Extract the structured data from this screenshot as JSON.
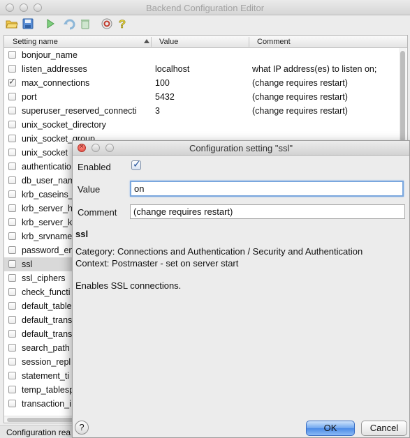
{
  "window": {
    "title": "Backend Configuration Editor"
  },
  "toolbar": {
    "icons": [
      "open-icon",
      "save-icon",
      "run-icon",
      "undo-icon",
      "delete-icon",
      "hint-icon",
      "help-icon"
    ]
  },
  "table": {
    "columns": [
      "Setting name",
      "Value",
      "Comment"
    ],
    "rows": [
      {
        "checked": false,
        "name": "bonjour_name",
        "value": "",
        "comment": ""
      },
      {
        "checked": false,
        "name": "listen_addresses",
        "value": "localhost",
        "comment": "what IP address(es) to listen on;"
      },
      {
        "checked": true,
        "name": "max_connections",
        "value": "100",
        "comment": "(change requires restart)"
      },
      {
        "checked": false,
        "name": "port",
        "value": "5432",
        "comment": "(change requires restart)"
      },
      {
        "checked": false,
        "name": "superuser_reserved_connecti",
        "value": "3",
        "comment": "(change requires restart)"
      },
      {
        "checked": false,
        "name": "unix_socket_directory",
        "value": "",
        "comment": ""
      },
      {
        "checked": false,
        "name": "unix_socket_group",
        "value": "",
        "comment": ""
      },
      {
        "checked": false,
        "name": "unix_socket",
        "value": "",
        "comment": ""
      },
      {
        "checked": false,
        "name": "authenticatio",
        "value": "",
        "comment": ""
      },
      {
        "checked": false,
        "name": "db_user_nam",
        "value": "",
        "comment": ""
      },
      {
        "checked": false,
        "name": "krb_caseins_",
        "value": "",
        "comment": ""
      },
      {
        "checked": false,
        "name": "krb_server_h",
        "value": "",
        "comment": ""
      },
      {
        "checked": false,
        "name": "krb_server_k",
        "value": "",
        "comment": ""
      },
      {
        "checked": false,
        "name": "krb_srvname",
        "value": "",
        "comment": ""
      },
      {
        "checked": false,
        "name": "password_en",
        "value": "",
        "comment": ""
      },
      {
        "checked": false,
        "name": "ssl",
        "value": "",
        "comment": ""
      },
      {
        "checked": false,
        "name": "ssl_ciphers",
        "value": "",
        "comment": ""
      },
      {
        "checked": false,
        "name": "check_functi",
        "value": "",
        "comment": ""
      },
      {
        "checked": false,
        "name": "default_table",
        "value": "",
        "comment": ""
      },
      {
        "checked": false,
        "name": "default_trans",
        "value": "",
        "comment": ""
      },
      {
        "checked": false,
        "name": "default_trans",
        "value": "",
        "comment": ""
      },
      {
        "checked": false,
        "name": "search_path",
        "value": "",
        "comment": ""
      },
      {
        "checked": false,
        "name": "session_repl",
        "value": "",
        "comment": ""
      },
      {
        "checked": false,
        "name": "statement_ti",
        "value": "",
        "comment": ""
      },
      {
        "checked": false,
        "name": "temp_tablesp",
        "value": "",
        "comment": ""
      },
      {
        "checked": false,
        "name": "transaction_i",
        "value": "",
        "comment": ""
      }
    ],
    "selected_row": "ssl"
  },
  "statusbar": {
    "text": "Configuration rea"
  },
  "dialog": {
    "title": "Configuration setting \"ssl\"",
    "enabled_label": "Enabled",
    "enabled": true,
    "value_label": "Value",
    "value": "on",
    "comment_label": "Comment",
    "comment": "(change requires restart)",
    "setting_name": "ssl",
    "category": "Category: Connections and Authentication / Security and Authentication",
    "context": "Context: Postmaster - set on server start",
    "description": "Enables SSL connections.",
    "help_label": "?",
    "ok_label": "OK",
    "cancel_label": "Cancel"
  }
}
